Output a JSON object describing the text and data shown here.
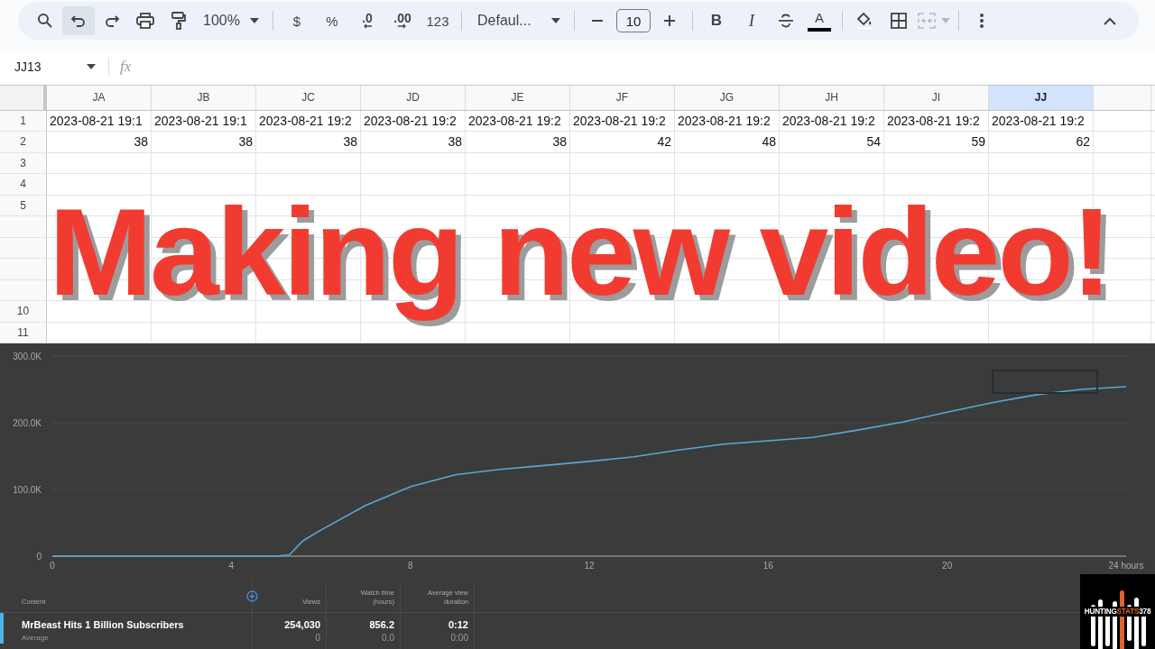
{
  "toolbar": {
    "items": [
      {
        "kind": "search",
        "hovered": false
      },
      {
        "kind": "undo",
        "hovered": true
      },
      {
        "kind": "redo",
        "hovered": false
      },
      {
        "kind": "print",
        "hovered": false
      },
      {
        "kind": "paint",
        "hovered": false
      },
      {
        "kind": "zoom",
        "label": "100%",
        "hovered": false
      },
      {
        "kind": "sep"
      },
      {
        "kind": "text",
        "label": "$",
        "hovered": false
      },
      {
        "kind": "text",
        "label": "%",
        "hovered": false
      },
      {
        "kind": "decrease_decimal",
        "label": ".0",
        "hovered": false
      },
      {
        "kind": "increase_decimal",
        "label": ".00",
        "hovered": false
      },
      {
        "kind": "text",
        "label": "123",
        "hovered": false
      },
      {
        "kind": "sep"
      },
      {
        "kind": "font",
        "label": "Defaul...",
        "hovered": false
      },
      {
        "kind": "sep"
      },
      {
        "kind": "minus",
        "hovered": false
      },
      {
        "kind": "size",
        "value": "10"
      },
      {
        "kind": "plus",
        "hovered": false
      },
      {
        "kind": "sep"
      },
      {
        "kind": "bold",
        "label": "B",
        "hovered": false
      },
      {
        "kind": "italic",
        "label": "I",
        "hovered": false
      },
      {
        "kind": "strike",
        "hovered": false
      },
      {
        "kind": "textcolor",
        "label": "A",
        "hovered": false
      },
      {
        "kind": "sep"
      },
      {
        "kind": "fill",
        "hovered": false
      },
      {
        "kind": "borders",
        "hovered": false
      },
      {
        "kind": "merge",
        "disabled": true
      },
      {
        "kind": "sep"
      },
      {
        "kind": "more",
        "hovered": false
      }
    ],
    "collapse": true
  },
  "formula_bar": {
    "cell_ref": "JJ13",
    "fx": "fx"
  },
  "sheet": {
    "columns": [
      {
        "label": "JA",
        "selected": false
      },
      {
        "label": "JB",
        "selected": false
      },
      {
        "label": "JC",
        "selected": false
      },
      {
        "label": "JD",
        "selected": false
      },
      {
        "label": "JE",
        "selected": false
      },
      {
        "label": "JF",
        "selected": false
      },
      {
        "label": "JG",
        "selected": false
      },
      {
        "label": "JH",
        "selected": false
      },
      {
        "label": "JI",
        "selected": false
      },
      {
        "label": "JJ",
        "selected": true
      }
    ],
    "rows": [
      {
        "number": "1",
        "kind": "text",
        "cells": [
          "2023-08-21 19:1",
          "2023-08-21 19:1",
          "2023-08-21 19:2",
          "2023-08-21 19:2",
          "2023-08-21 19:2",
          "2023-08-21 19:2",
          "2023-08-21 19:2",
          "2023-08-21 19:2",
          "2023-08-21 19:2",
          "2023-08-21 19:2"
        ]
      },
      {
        "number": "2",
        "kind": "number",
        "cells": [
          "38",
          "38",
          "38",
          "38",
          "38",
          "42",
          "48",
          "54",
          "59",
          "62"
        ]
      },
      {
        "number": "3",
        "cells": []
      },
      {
        "number": "4",
        "cells": []
      },
      {
        "number": "5",
        "cells": []
      },
      {
        "cells": []
      },
      {
        "cells": []
      },
      {
        "cells": []
      },
      {
        "cells": []
      },
      {
        "number": "10",
        "cells": []
      },
      {
        "number": "11",
        "cells": []
      }
    ],
    "selected_cell_visible": true
  },
  "headline": "Making new video!",
  "analytics": {
    "chart_data": {
      "type": "line",
      "x": [
        0,
        1,
        2,
        3,
        4,
        5,
        5.3,
        5.6,
        6,
        7,
        8,
        9,
        10,
        11,
        12,
        13,
        14,
        15,
        16,
        17,
        18,
        19,
        20,
        21,
        22,
        23,
        24
      ],
      "series": [
        {
          "color": "#5aa8d6",
          "values": [
            0,
            0,
            0,
            0,
            0,
            0,
            2000,
            23000,
            39000,
            76000,
            104000,
            122000,
            130000,
            136000,
            142000,
            149000,
            159000,
            168000,
            173000,
            178000,
            189000,
            201000,
            216000,
            230000,
            242000,
            250000,
            254000
          ]
        }
      ],
      "xlim": [
        0,
        24
      ],
      "ylim": [
        0,
        300000
      ],
      "xticks": [
        0,
        4,
        8,
        12,
        16,
        20,
        {
          "value": 24,
          "label": "24 hours"
        }
      ],
      "yticks": [
        {
          "value": 0,
          "label": "0"
        },
        {
          "value": 100000,
          "label": "100.0K"
        },
        {
          "value": 200000,
          "label": "200.0K"
        },
        {
          "value": 300000,
          "label": "300.0K"
        }
      ]
    },
    "table": {
      "columns": [
        "Content",
        "Views",
        "Watch time (hours)",
        "Average view duration"
      ],
      "rows": [
        {
          "title": "MrBeast Hits 1 Billion Subscribers",
          "subtitle": "Average",
          "values": [
            "254,030",
            "856.2",
            "0:12"
          ],
          "averages": [
            "0",
            "0.0",
            "0:00"
          ],
          "highlighted": true
        }
      ]
    }
  },
  "logo": {
    "parts": [
      {
        "text": "HUNTING",
        "accent": false
      },
      {
        "text": "STATS",
        "accent": true
      },
      {
        "text": "378",
        "accent": false
      }
    ]
  }
}
